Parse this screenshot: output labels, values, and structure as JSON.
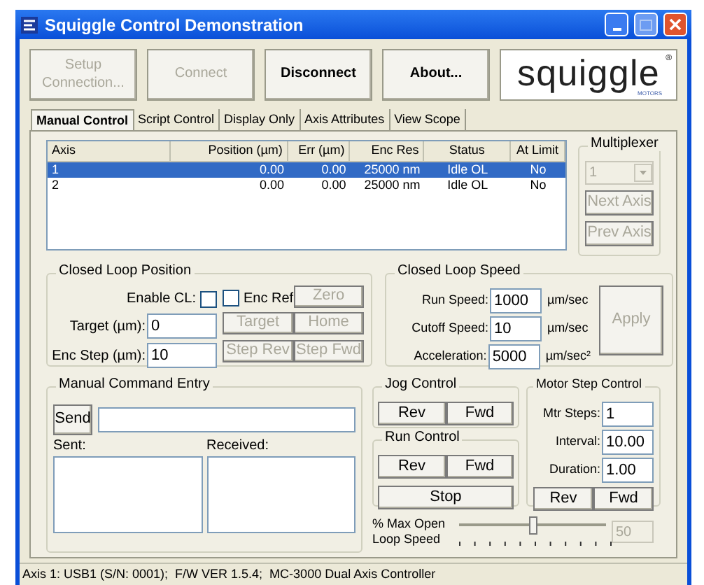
{
  "window": {
    "title": "Squiggle Control Demonstration"
  },
  "toolbar": [
    {
      "label": "Setup Connection...",
      "disabled": true
    },
    {
      "label": "Connect",
      "disabled": true
    },
    {
      "label": "Disconnect",
      "disabled": false
    },
    {
      "label": "About...",
      "disabled": false
    }
  ],
  "logo": {
    "name": "squiggle",
    "mark": "®",
    "sub": "MOTORS"
  },
  "tabs": [
    {
      "label": "Manual Control",
      "selected": true
    },
    {
      "label": "Script Control",
      "selected": false
    },
    {
      "label": "Display Only",
      "selected": false
    },
    {
      "label": "Axis Attributes",
      "selected": false
    },
    {
      "label": "View Scope",
      "selected": false
    }
  ],
  "axis_table": {
    "columns": [
      "Axis",
      "Position (µm)",
      "Err (µm)",
      "Enc Res",
      "Status",
      "At Limit"
    ],
    "rows": [
      {
        "cells": [
          "1",
          "0.00",
          "0.00",
          "25000 nm",
          "Idle OL",
          "No"
        ],
        "selected": true
      },
      {
        "cells": [
          "2",
          "0.00",
          "0.00",
          "25000 nm",
          "Idle OL",
          "No"
        ],
        "selected": false
      }
    ]
  },
  "multiplexer": {
    "title": "Multiplexer",
    "value": "1",
    "disabled": true,
    "buttons": [
      {
        "label": "Next Axis",
        "disabled": true
      },
      {
        "label": "Prev Axis",
        "disabled": true
      }
    ]
  },
  "closed_loop_position": {
    "title": "Closed Loop Position",
    "enable_cl": {
      "label": "Enable CL:",
      "checked": false
    },
    "enc_ref": {
      "label": "Enc Ref",
      "checked": false
    },
    "fields": [
      {
        "label": "Target (µm):",
        "value": "0"
      },
      {
        "label": "Enc Step (µm):",
        "value": "10"
      }
    ],
    "buttons": [
      {
        "label": "Zero",
        "disabled": true
      },
      {
        "label": "Target",
        "disabled": true
      },
      {
        "label": "Home",
        "disabled": true
      },
      {
        "label": "Step Rev",
        "disabled": true
      },
      {
        "label": "Step Fwd",
        "disabled": true
      }
    ]
  },
  "closed_loop_speed": {
    "title": "Closed Loop Speed",
    "fields": [
      {
        "label": "Run Speed:",
        "value": "1000",
        "unit": "µm/sec"
      },
      {
        "label": "Cutoff Speed:",
        "value": "10",
        "unit": "µm/sec"
      },
      {
        "label": "Acceleration:",
        "value": "5000",
        "unit": "µm/sec²"
      }
    ],
    "apply": {
      "label": "Apply",
      "disabled": true
    }
  },
  "manual_command": {
    "title": "Manual Command Entry",
    "send": "Send",
    "sent_label": "Sent:",
    "received_label": "Received:"
  },
  "jog_control": {
    "title": "Jog Control",
    "buttons": [
      "Rev",
      "Fwd"
    ]
  },
  "run_control": {
    "title": "Run Control",
    "buttons": [
      "Rev",
      "Fwd"
    ],
    "stop": "Stop"
  },
  "motor_step": {
    "title": "Motor Step Control",
    "fields": [
      {
        "label": "Mtr Steps:",
        "value": "1"
      },
      {
        "label": "Interval:",
        "value": "10.00"
      },
      {
        "label": "Duration:",
        "value": "1.00"
      }
    ],
    "buttons": [
      "Rev",
      "Fwd"
    ]
  },
  "speed_slider": {
    "label": "% Max Open Loop Speed",
    "level": 0.5,
    "reading": "50"
  },
  "status_bar": "Axis 1: USB1 (S/N: 0001);  F/W VER 1.5.4;  MC-3000 Dual Axis Controller"
}
